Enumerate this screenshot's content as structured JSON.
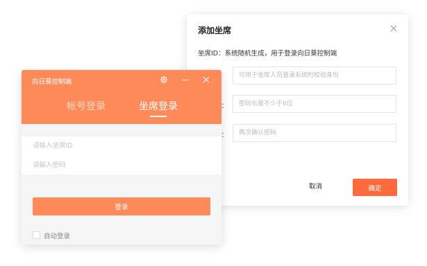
{
  "add_seat_dialog": {
    "title": "添加坐席",
    "description": "坐席ID：系统随机生成，用于登录向日葵控制端",
    "fields": [
      {
        "label": "",
        "placeholder": "可用于坐席人员登录系统时校验身份"
      },
      {
        "label": "码：",
        "placeholder": "密码长度不少于6位"
      },
      {
        "label": "码：",
        "placeholder": "再次确认密码"
      }
    ],
    "cancel_label": "取消",
    "ok_label": "确定",
    "accent_color": "#ff6a3d"
  },
  "login_window": {
    "title": "向日葵控制端",
    "controls": [
      "gear-icon",
      "minimize-icon",
      "close-icon"
    ],
    "tabs": [
      {
        "label": "帐号登录",
        "active": false
      },
      {
        "label": "坐席登录",
        "active": true
      }
    ],
    "seat_id_placeholder": "请输入坐席ID",
    "password_placeholder": "请输入密码",
    "login_button": "登录",
    "auto_login_label": "自动登录",
    "auto_login_checked": false,
    "header_color": "#fd8a58"
  }
}
